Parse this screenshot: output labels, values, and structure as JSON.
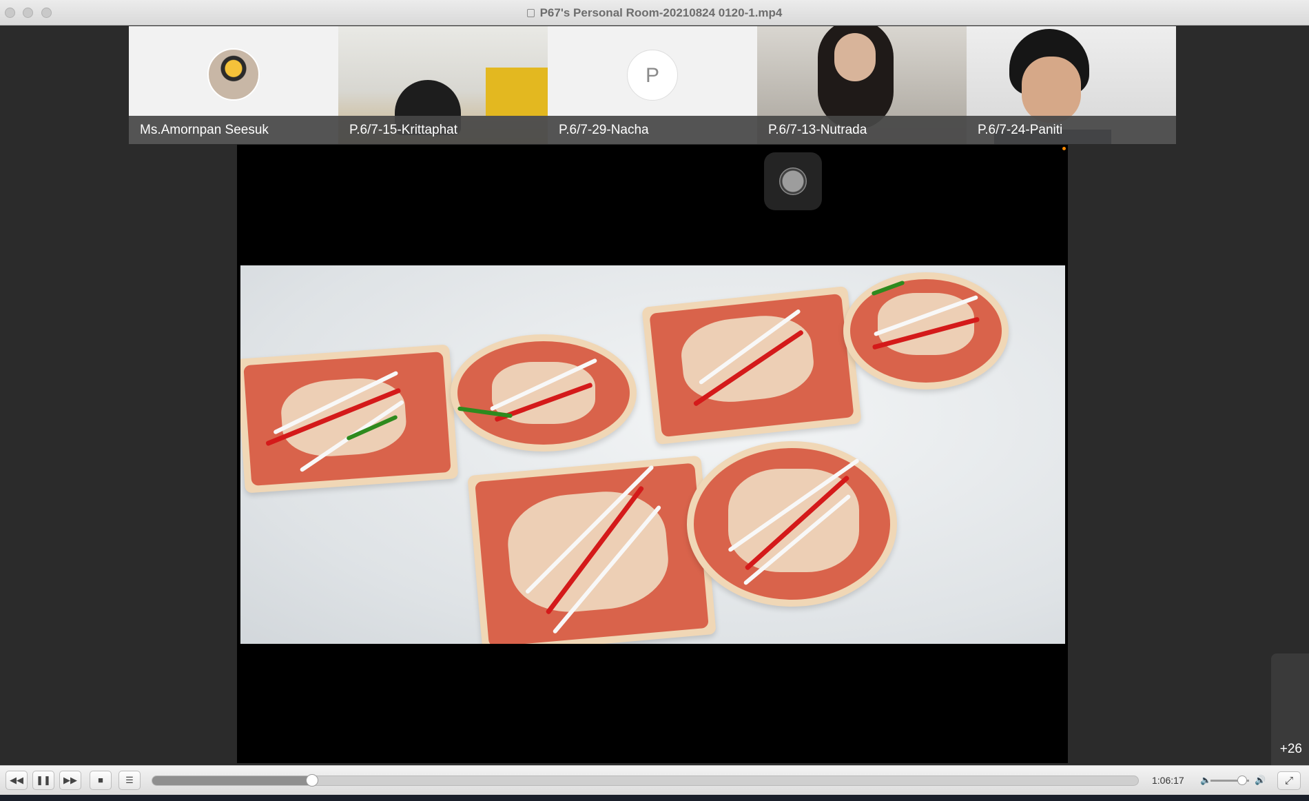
{
  "window": {
    "title": "P67's Personal Room-20210824 0120-1.mp4",
    "title_icon": "document-icon"
  },
  "participants": [
    {
      "name": "Ms.Amornpan Seesuk",
      "view": "profile-photo"
    },
    {
      "name": "P.6/7-15-Krittaphat",
      "view": "camera"
    },
    {
      "name": "P.6/7-29-Nacha",
      "view": "initial",
      "initial": "P"
    },
    {
      "name": "P.6/7-13-Nutrada",
      "view": "camera"
    },
    {
      "name": "P.6/7-24-Paniti",
      "view": "camera"
    }
  ],
  "shared_content": {
    "description_icon": "camera-shutter-icon"
  },
  "overflow_participants": "+26",
  "player": {
    "time": "1:06:17",
    "progress": 0.162,
    "volume": 0.82,
    "buttons": {
      "rewind": "rewind-icon",
      "pause": "pause-icon",
      "fast_forward": "fast-forward-icon",
      "stop": "stop-icon",
      "playlist": "list-icon",
      "fullscreen": "fullscreen-icon"
    }
  },
  "colors": {
    "titlebar": "#e3e3e3",
    "stage_background": "#2b2b2b",
    "record_indicator": "#ff8a00"
  }
}
